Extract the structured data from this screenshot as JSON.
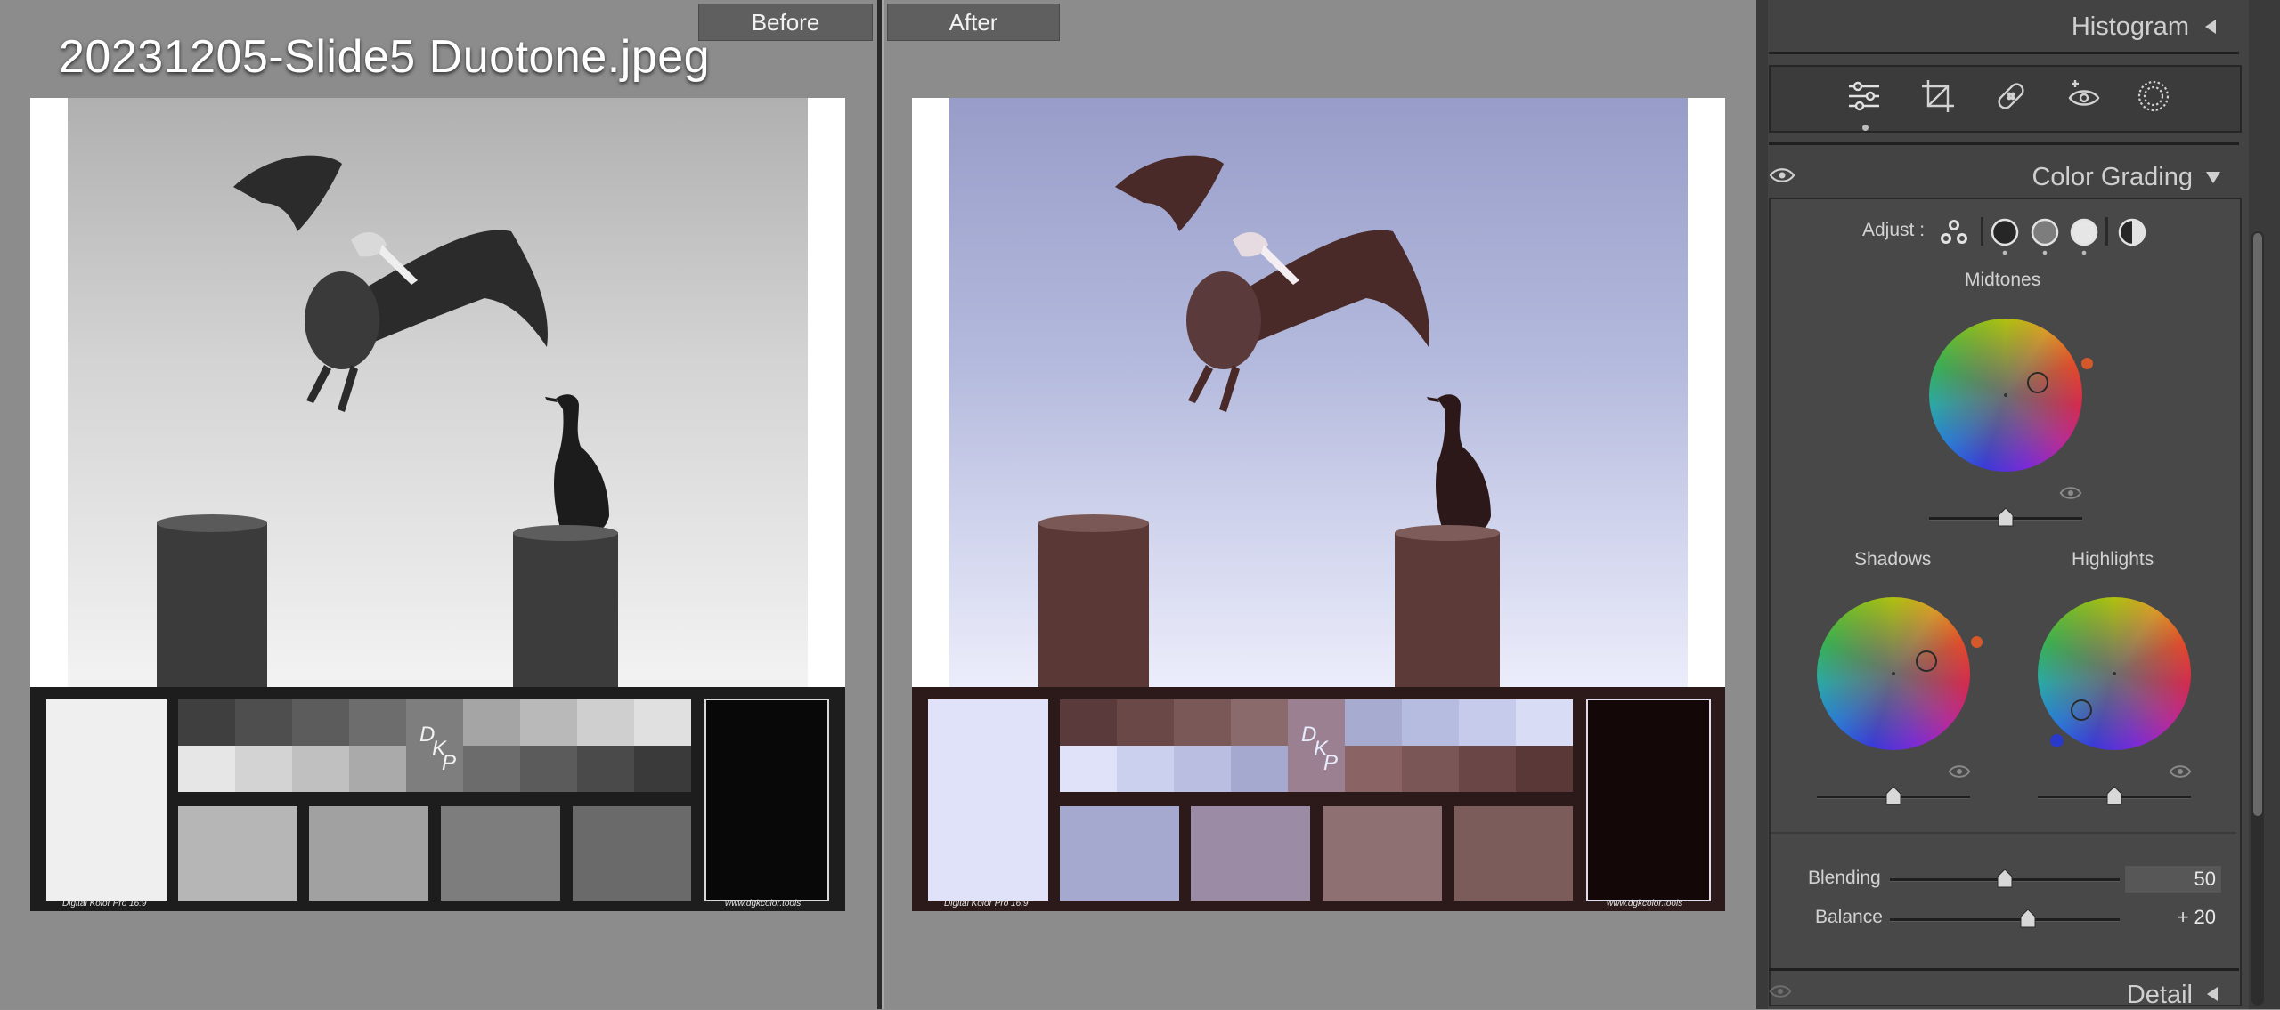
{
  "compare": {
    "before_label": "Before",
    "after_label": "After",
    "file_title": "20231205-Slide5 Duotone.jpeg"
  },
  "target_card": {
    "footer_left": "Digital Kolor Pro 16:9",
    "footer_right": "www.dgkcolor.tools",
    "logo_letters": [
      "D",
      "K",
      "P"
    ]
  },
  "panel": {
    "histogram_label": "Histogram",
    "tools": [
      "edit-sliders",
      "crop",
      "healing",
      "red-eye",
      "masking"
    ],
    "color_grading": {
      "title": "Color Grading",
      "adjust_label": "Adjust :",
      "adjust_modes": [
        "3-way",
        "shadows",
        "midtones",
        "highlights",
        "global"
      ],
      "midtones_label": "Midtones",
      "shadows_label": "Shadows",
      "highlights_label": "Highlights",
      "blending_label": "Blending",
      "blending_value": "50",
      "balance_label": "Balance",
      "balance_value": "+ 20",
      "blending_fraction": 0.5,
      "balance_fraction": 0.6
    },
    "detail_label": "Detail"
  },
  "colors": {
    "panel_bg": "#434343",
    "before_sky": "#c9c9c9",
    "after_sky": "#a3aacf",
    "after_shadow_tint": "#4a2a28"
  }
}
